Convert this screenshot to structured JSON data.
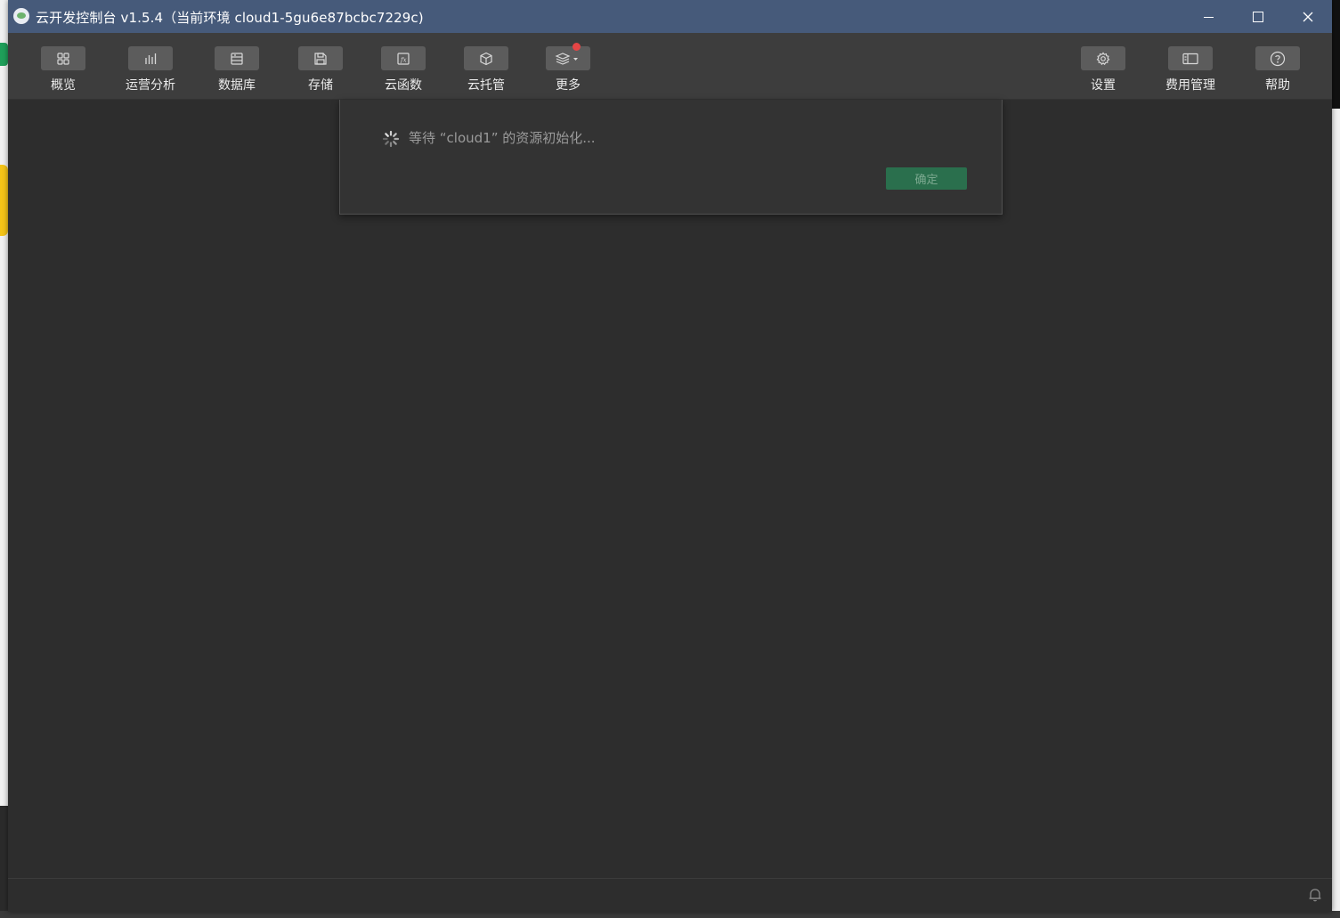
{
  "window": {
    "title": "云开发控制台 v1.5.4（当前环境 cloud1-5gu6e87bcbc7229c)",
    "controls": {
      "minimize": "minimize-icon",
      "maximize": "maximize-icon",
      "close": "close-icon"
    }
  },
  "toolbar": {
    "left_items": [
      {
        "label": "概览",
        "icon": "grid-icon"
      },
      {
        "label": "运营分析",
        "icon": "bar-chart-icon"
      },
      {
        "label": "数据库",
        "icon": "database-icon"
      },
      {
        "label": "存储",
        "icon": "save-icon"
      },
      {
        "label": "云函数",
        "icon": "function-icon"
      },
      {
        "label": "云托管",
        "icon": "cube-icon"
      },
      {
        "label": "更多",
        "icon": "layers-icon",
        "has_notification": true
      }
    ],
    "right_items": [
      {
        "label": "设置",
        "icon": "gear-icon"
      },
      {
        "label": "费用管理",
        "icon": "billing-icon"
      },
      {
        "label": "帮助",
        "icon": "help-icon"
      }
    ]
  },
  "dialog": {
    "message": "等待 “cloud1” 的资源初始化...",
    "confirm_label": "确定"
  },
  "colors": {
    "titlebar": "#465a7a",
    "toolbar": "#3d3d3d",
    "content": "#2d2d2d",
    "confirm": "#2a6f4d",
    "notification_dot": "#e64545"
  }
}
